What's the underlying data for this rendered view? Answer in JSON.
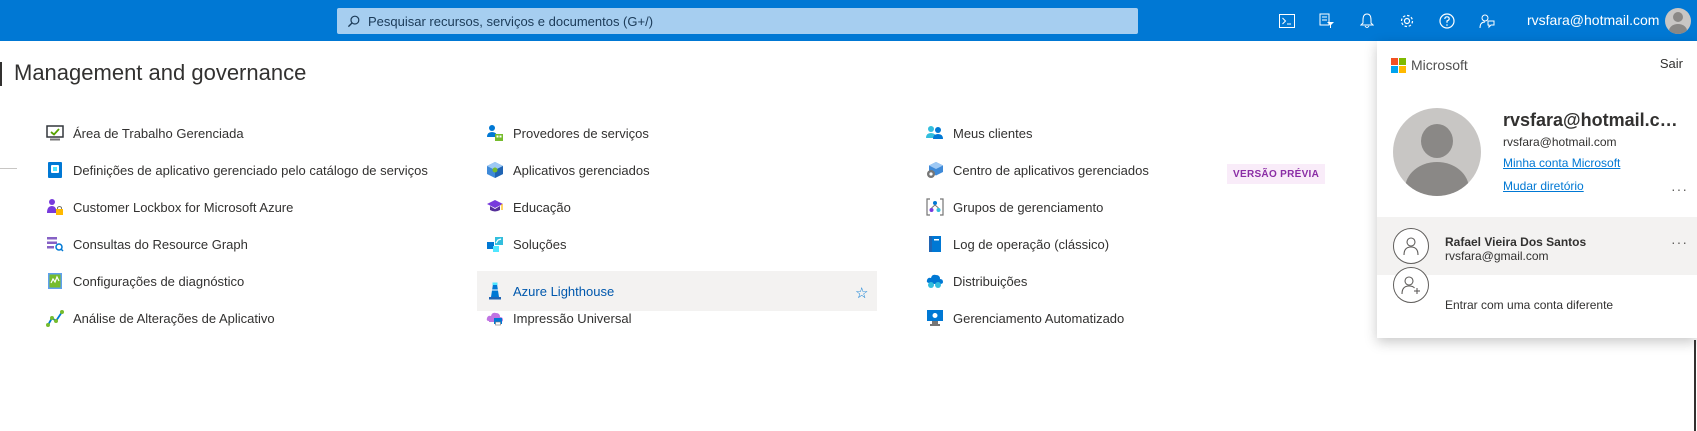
{
  "search": {
    "placeholder": "Pesquisar recursos, serviços e documentos (G+/)"
  },
  "topbar": {
    "icons": [
      "terminal-icon",
      "directory-filter-icon",
      "bell-icon",
      "gear-icon",
      "help-icon",
      "feedback-icon"
    ],
    "user_email": "rvsfara@hotmail.com",
    "color": "#0078d4"
  },
  "page": {
    "title": "Management and governance"
  },
  "columns": [
    {
      "items": [
        {
          "label": "Área de Trabalho Gerenciada",
          "icon": "managed-desktop-icon"
        },
        {
          "label": "Definições de aplicativo gerenciado pelo catálogo de serviços",
          "icon": "service-catalog-icon"
        },
        {
          "label": "Customer Lockbox for Microsoft Azure",
          "icon": "lockbox-icon"
        },
        {
          "label": "Consultas do Resource Graph",
          "icon": "resource-graph-icon"
        },
        {
          "label": "Configurações de diagnóstico",
          "icon": "diagnostic-settings-icon"
        },
        {
          "label": "Análise de Alterações de Aplicativo",
          "icon": "change-analysis-icon"
        }
      ]
    },
    {
      "items": [
        {
          "label": "Provedores de serviços",
          "icon": "service-providers-icon"
        },
        {
          "label": "Aplicativos gerenciados",
          "icon": "managed-apps-icon"
        },
        {
          "label": "Educação",
          "icon": "education-icon"
        },
        {
          "label": "Soluções",
          "icon": "solutions-icon"
        },
        {
          "label": "Azure Lighthouse",
          "icon": "lighthouse-icon",
          "selected": true
        },
        {
          "label": "Impressão Universal",
          "icon": "universal-print-icon"
        }
      ]
    },
    {
      "items": [
        {
          "label": "Meus clientes",
          "icon": "my-customers-icon"
        },
        {
          "label": "Centro de aplicativos gerenciados",
          "icon": "managed-apps-center-icon",
          "badge": "VERSÃO PRÉVIA"
        },
        {
          "label": "Grupos de gerenciamento",
          "icon": "management-groups-icon"
        },
        {
          "label": "Log de operação (clássico)",
          "icon": "operation-log-icon"
        },
        {
          "label": "Distribuições",
          "icon": "distributions-icon"
        },
        {
          "label": "Gerenciamento Automatizado",
          "icon": "automanage-icon"
        }
      ]
    }
  ],
  "account_panel": {
    "brand": "Microsoft",
    "sign_out": "Sair",
    "name": "rvsfara@hotmail.com",
    "email": "rvsfara@hotmail.com",
    "my_account": "Minha conta Microsoft",
    "switch_directory": "Mudar diretório",
    "other_account": {
      "name": "Rafael Vieira Dos Santos",
      "email": "rvsfara@gmail.com"
    },
    "sign_in_other": "Entrar com uma conta diferente",
    "more": "···"
  }
}
